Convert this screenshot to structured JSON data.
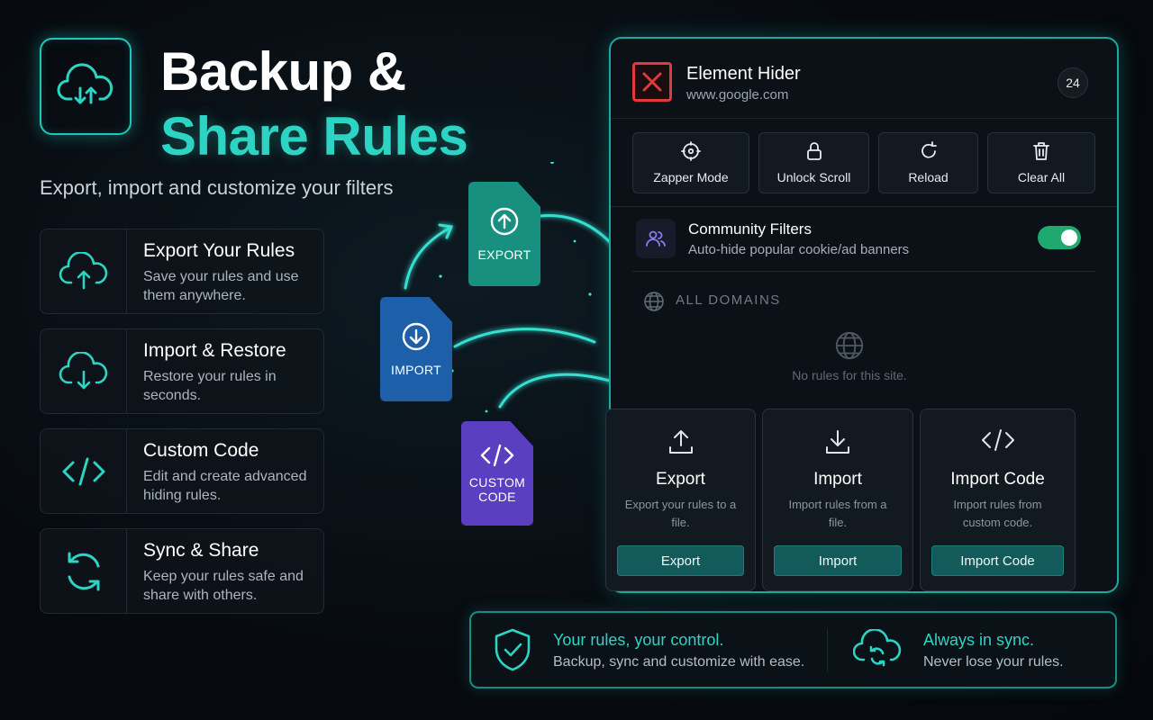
{
  "hero": {
    "title_line1": "Backup &",
    "title_line2": "Share Rules",
    "subtitle": "Export, import and customize your filters"
  },
  "features": [
    {
      "title": "Export Your Rules",
      "desc_line1": "Save your rules and use",
      "desc_line2": "them anywhere.",
      "icon": "cloud-upload-icon"
    },
    {
      "title": "Import & Restore",
      "desc_line1": "Restore your rules in",
      "desc_line2": "seconds.",
      "icon": "cloud-download-icon"
    },
    {
      "title": "Custom Code",
      "desc_line1": "Edit and create advanced",
      "desc_line2": "hiding rules.",
      "icon": "code-icon"
    },
    {
      "title": "Sync & Share",
      "desc_line1": "Keep your rules safe and",
      "desc_line2": "share with others.",
      "icon": "sync-icon"
    }
  ],
  "files": {
    "export": "EXPORT",
    "import": "IMPORT",
    "custom_line1": "CUSTOM",
    "custom_line2": "CODE"
  },
  "panel": {
    "app_name": "Element Hider",
    "domain": "www.google.com",
    "badge_count": "24",
    "tools": [
      {
        "label": "Zapper Mode",
        "icon": "crosshair-icon"
      },
      {
        "label": "Unlock Scroll",
        "icon": "lock-icon"
      },
      {
        "label": "Reload",
        "icon": "reload-icon"
      },
      {
        "label": "Clear All",
        "icon": "trash-icon"
      }
    ],
    "community": {
      "title": "Community Filters",
      "desc": "Auto-hide popular cookie/ad banners",
      "enabled": true
    },
    "domains_label": "ALL DOMAINS",
    "empty_text": "No rules for this site.",
    "actions": [
      {
        "title": "Export",
        "desc": "Export your rules to a file.",
        "button": "Export",
        "icon": "upload-icon"
      },
      {
        "title": "Import",
        "desc": "Import rules from a file.",
        "button": "Import",
        "icon": "download-icon"
      },
      {
        "title": "Import Code",
        "desc": "Import rules from custom code.",
        "button": "Import Code",
        "icon": "code-icon"
      }
    ]
  },
  "bottom": {
    "left_title": "Your rules, your control.",
    "left_desc": "Backup, sync and customize with ease.",
    "right_title": "Always in sync.",
    "right_desc": "Never lose your rules."
  },
  "colors": {
    "accent": "#2dd4c4",
    "toggle_on": "#1fa870",
    "close_red": "#e03b3b",
    "file_export": "#18907f",
    "file_import": "#1d5fa8",
    "file_custom": "#5a3fc0"
  }
}
